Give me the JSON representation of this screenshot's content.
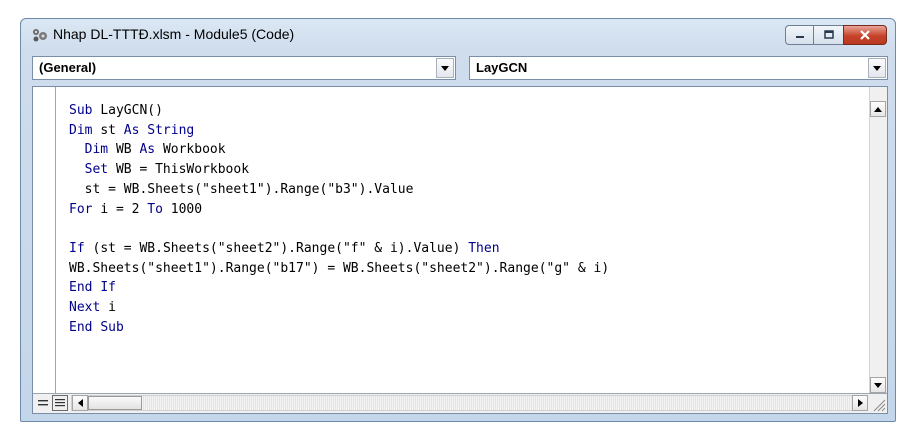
{
  "window": {
    "title": "Nhap DL-TTTĐ.xlsm - Module5 (Code)",
    "icon": "vba-project-icon",
    "controls": [
      "minimize-icon",
      "maximize-icon",
      "close-icon"
    ]
  },
  "object_combo": {
    "selected": "(General)"
  },
  "procedure_combo": {
    "selected": "LayGCN"
  },
  "code": {
    "lines": [
      "Sub LayGCN()",
      "Dim st As String",
      "  Dim WB As Workbook",
      "  Set WB = ThisWorkbook",
      "  st = WB.Sheets(\"sheet1\").Range(\"b3\").Value",
      "For i = 2 To 1000",
      "",
      "If (st = WB.Sheets(\"sheet2\").Range(\"f\" & i).Value) Then",
      "WB.Sheets(\"sheet1\").Range(\"b17\") = WB.Sheets(\"sheet2\").Range(\"g\" & i)",
      "End If",
      "Next i",
      "End Sub"
    ],
    "keywords": [
      "Sub",
      "Dim",
      "As",
      "String",
      "Set",
      "For",
      "To",
      "If",
      "Then",
      "End",
      "Next"
    ],
    "keyword_color": "#00008b"
  },
  "colors": {
    "frame": "#c4d6ea",
    "close_button": "#c6432a"
  },
  "status": {
    "procedure_view_icon": "procedure-view-icon",
    "full_module_view_icon": "full-module-view-icon"
  }
}
